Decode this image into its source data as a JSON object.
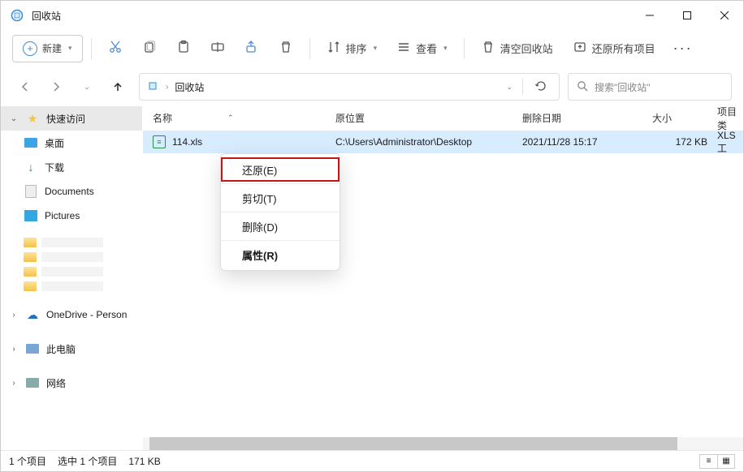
{
  "window": {
    "title": "回收站"
  },
  "toolbar": {
    "new_label": "新建",
    "sort_label": "排序",
    "view_label": "查看",
    "empty_label": "清空回收站",
    "restore_all_label": "还原所有项目"
  },
  "address": {
    "location": "回收站"
  },
  "search": {
    "placeholder": "搜索\"回收站\""
  },
  "sidebar": {
    "quick_access": "快速访问",
    "items": [
      {
        "label": "桌面"
      },
      {
        "label": "下载"
      },
      {
        "label": "Documents"
      },
      {
        "label": "Pictures"
      }
    ],
    "onedrive": "OneDrive - Person",
    "this_pc": "此电脑",
    "network": "网络"
  },
  "columns": {
    "name": "名称",
    "orig": "原位置",
    "date": "删除日期",
    "size": "大小",
    "type": "项目类"
  },
  "rows": [
    {
      "name": "114.xls",
      "orig": "C:\\Users\\Administrator\\Desktop",
      "date": "2021/11/28 15:17",
      "size": "172 KB",
      "type": "XLS 工"
    }
  ],
  "context_menu": {
    "restore": "还原(E)",
    "cut": "剪切(T)",
    "delete": "删除(D)",
    "properties": "属性(R)"
  },
  "status": {
    "count": "1 个项目",
    "selected": "选中 1 个项目",
    "size": "171 KB"
  }
}
